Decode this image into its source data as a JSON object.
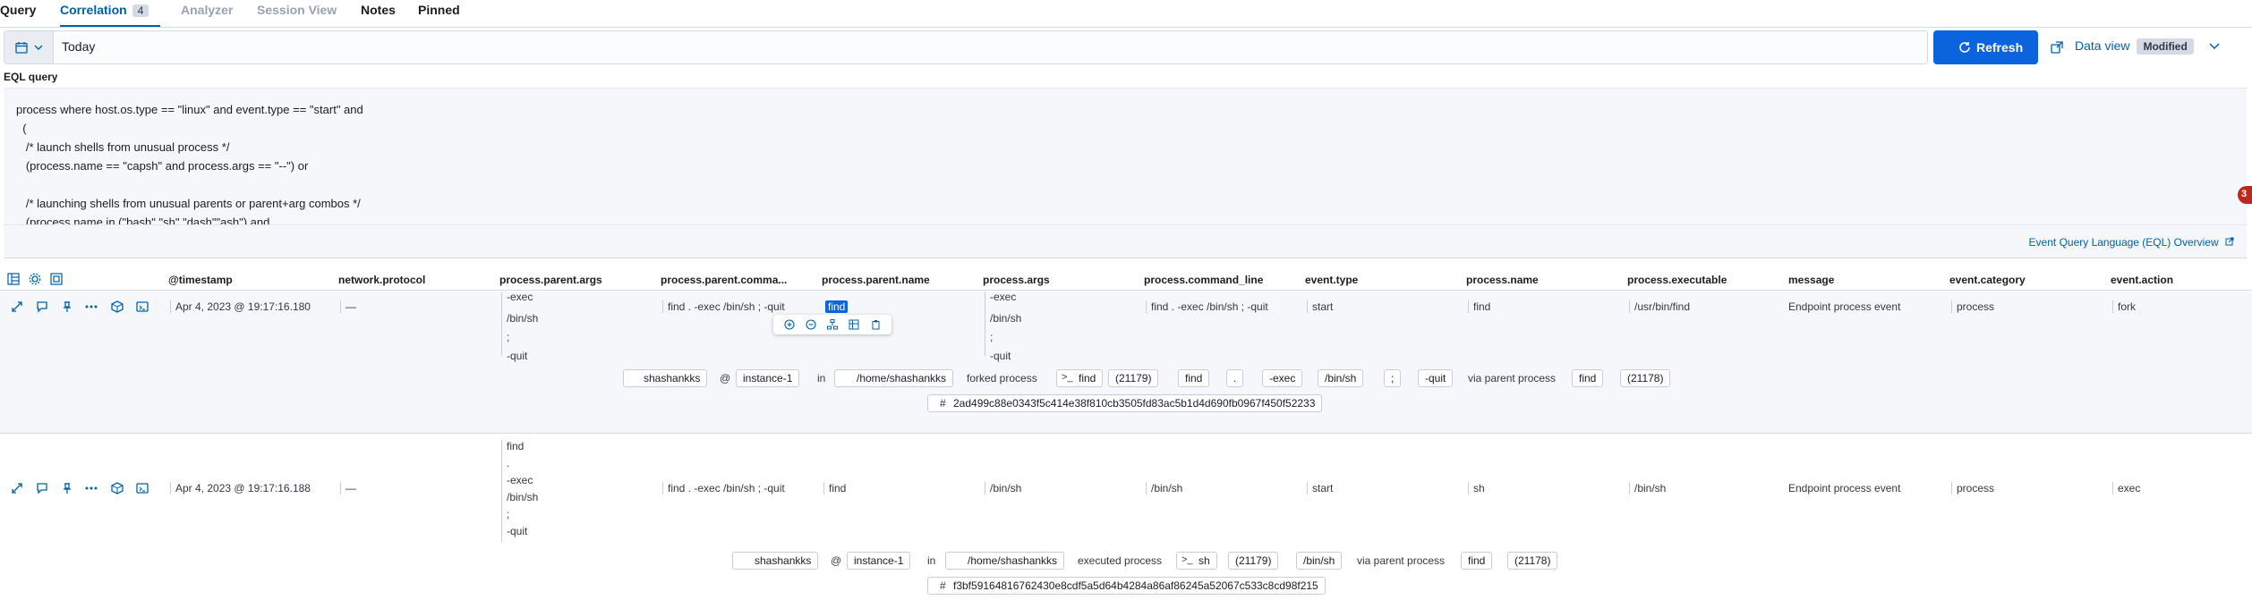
{
  "tabs": {
    "query": "Query",
    "correlation": "Correlation",
    "correlation_count": "4",
    "analyzer": "Analyzer",
    "session_view": "Session View",
    "notes": "Notes",
    "pinned": "Pinned"
  },
  "date_picker": {
    "value": "Today"
  },
  "toolbar": {
    "refresh_label": "Refresh",
    "data_view_label": "Data view",
    "data_view_badge": "Modified"
  },
  "eql": {
    "label": "EQL query",
    "lines": [
      "process where host.os.type == \"linux\" and event.type == \"start\" and",
      "  (",
      "   /* launch shells from unusual process */",
      "   (process.name == \"capsh\" and process.args == \"--\") or",
      "",
      "   /* launching shells from unusual parents or parent+arg combos */",
      "   (process.name in (\"bash\" \"sh\" \"dash\"\"ash\") and"
    ],
    "overview_link": "Event Query Language (EQL) Overview",
    "error_count": "3"
  },
  "table": {
    "columns": [
      "@timestamp",
      "network.protocol",
      "process.parent.args",
      "process.parent.comma...",
      "process.parent.name",
      "process.args",
      "process.command_line",
      "event.type",
      "process.name",
      "process.executable",
      "message",
      "event.category",
      "event.action"
    ],
    "rows": [
      {
        "timestamp": "Apr 4, 2023 @ 19:17:16.180",
        "network_protocol": "—",
        "parent_args": [
          "-exec",
          "/bin/sh",
          ";",
          "-quit"
        ],
        "parent_command": "find . -exec /bin/sh ; -quit",
        "parent_name": "find",
        "args": [
          "-exec",
          "/bin/sh",
          ";",
          "-quit"
        ],
        "command_line": "find . -exec /bin/sh ; -quit",
        "event_type": "start",
        "process_name": "find",
        "executable": "/usr/bin/find",
        "message": "Endpoint process event",
        "event_category": "process",
        "event_action": "fork",
        "summary": {
          "user": "shashankks",
          "at": "@",
          "host": "instance-1",
          "in": "in",
          "dir": "/home/shashankks",
          "verb": "forked process",
          "proc": "find",
          "pid": "(21179)",
          "args": [
            "find",
            ".",
            "-exec",
            "/bin/sh",
            ";",
            "-quit"
          ],
          "via": "via parent process",
          "parent": "find",
          "ppid": "(21178)",
          "hash": "2ad499c88e0343f5c414e38f810cb3505fd83ac5b1d4d690fb0967f450f52233"
        }
      },
      {
        "timestamp": "Apr 4, 2023 @ 19:17:16.188",
        "network_protocol": "—",
        "parent_args": [
          "find",
          ".",
          "-exec",
          "/bin/sh",
          ";",
          "-quit"
        ],
        "parent_command": "find . -exec /bin/sh ; -quit",
        "parent_name": "find",
        "args": [
          "/bin/sh"
        ],
        "command_line": "/bin/sh",
        "event_type": "start",
        "process_name": "sh",
        "executable": "/bin/sh",
        "message": "Endpoint process event",
        "event_category": "process",
        "event_action": "exec",
        "summary": {
          "user": "shashankks",
          "at": "@",
          "host": "instance-1",
          "in": "in",
          "dir": "/home/shashankks",
          "verb": "executed process",
          "proc": "sh",
          "pid": "(21179)",
          "args": [
            "/bin/sh"
          ],
          "via": "via parent process",
          "parent": "find",
          "ppid": "(21178)",
          "hash": "f3bf59164816762430e8cdf5a5d64b4284a86af86245a52067c533c8cd98f215"
        }
      }
    ]
  },
  "colors": {
    "accent": "#0061a6",
    "primary_button": "#0b64dd",
    "error": "#bd271e"
  }
}
